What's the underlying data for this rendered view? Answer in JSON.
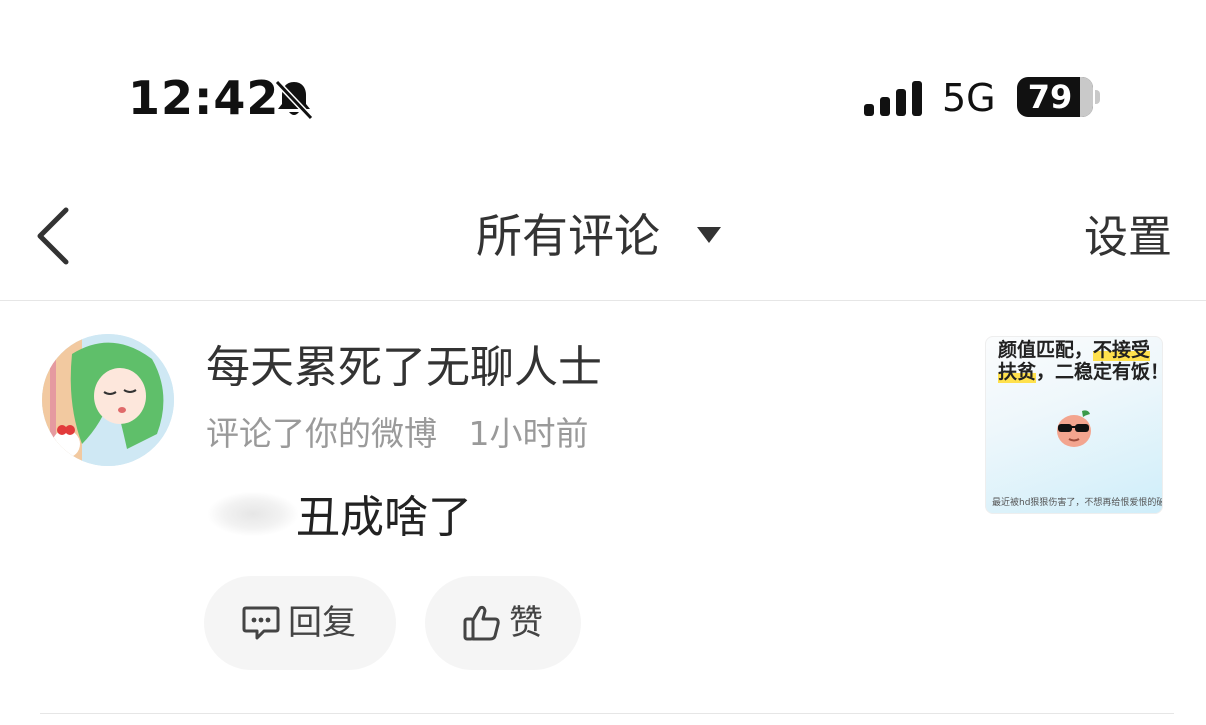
{
  "status_bar": {
    "time": "12:42",
    "network": "5G",
    "battery": "79",
    "icons": [
      "bell-slash-icon",
      "signal-icon",
      "battery-icon"
    ]
  },
  "nav": {
    "title": "所有评论",
    "settings_label": "设置",
    "icons": [
      "back-chevron-icon",
      "caret-down-icon"
    ]
  },
  "comment": {
    "username": "每天累死了无聊人士",
    "action": "评论了你的微博",
    "time_ago": "1小时前",
    "text": "丑成啥了",
    "reply_label": "回复",
    "like_label": "赞",
    "thumbnail": {
      "line1_a": "颜值匹配，",
      "line1_b": "不接受",
      "line2_a": "扶贫",
      "line2_b": "，二稳定有饭！",
      "caption": "最近被hd狠狠伤害了，不想再给恨爱恨的破cp，我"
    }
  },
  "colors": {
    "text_primary": "#222222",
    "text_secondary": "#9a9a9a",
    "button_bg": "#f5f5f5",
    "highlight": "#ffe14d"
  }
}
